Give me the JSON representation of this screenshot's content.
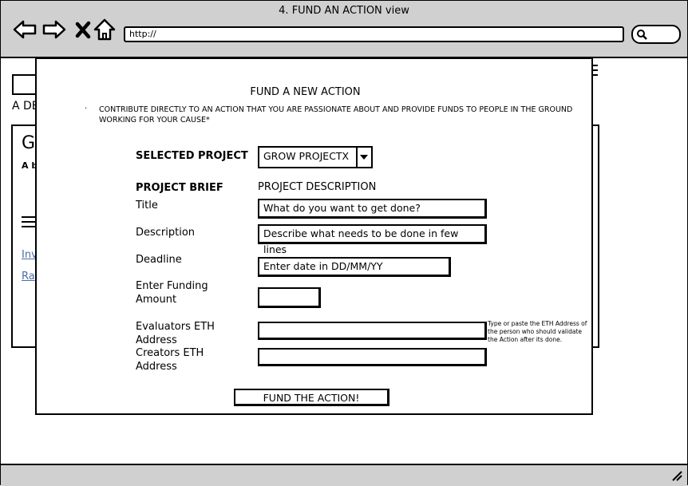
{
  "window": {
    "title": "4. FUND AN ACTION view"
  },
  "browser": {
    "url": "http://",
    "icons": [
      "back-arrow-icon",
      "forward-arrow-icon",
      "close-icon",
      "home-icon",
      "search-icon"
    ]
  },
  "background": {
    "text_a": "A DE",
    "big_letter": "G",
    "small_bold": "A b",
    "link1": "Inv",
    "link2": "Ra"
  },
  "modal": {
    "title": "FUND A NEW ACTION",
    "bullet": "·",
    "intro": "CONTRIBUTE DIRECTLY TO AN ACTION THAT YOU ARE PASSIONATE ABOUT AND PROVIDE FUNDS TO PEOPLE IN THE GROUND WORKING FOR YOUR CAUSE*",
    "selected_project_label": "SELECTED PROJECT",
    "selected_project_value": "GROW PROJECTX",
    "project_brief_label": "PROJECT BRIEF",
    "project_description_label": "PROJECT DESCRIPTION",
    "title_label": "Title",
    "title_value": "What do you want to get done?",
    "description_label": "Description",
    "description_value": "Describe what needs to be done in few lines",
    "deadline_label": "Deadline",
    "deadline_value": "Enter date in DD/MM/YY",
    "funding_label": "Enter Funding Amount",
    "funding_value": "",
    "evaluators_label": "Evaluators ETH Address",
    "evaluators_value": "",
    "evaluators_hint": "Type or paste the ETH Address of the person who should validate the Action after its done.",
    "creators_label": "Creators ETH Address",
    "creators_value": "",
    "submit_label": "FUND THE ACTION!"
  }
}
